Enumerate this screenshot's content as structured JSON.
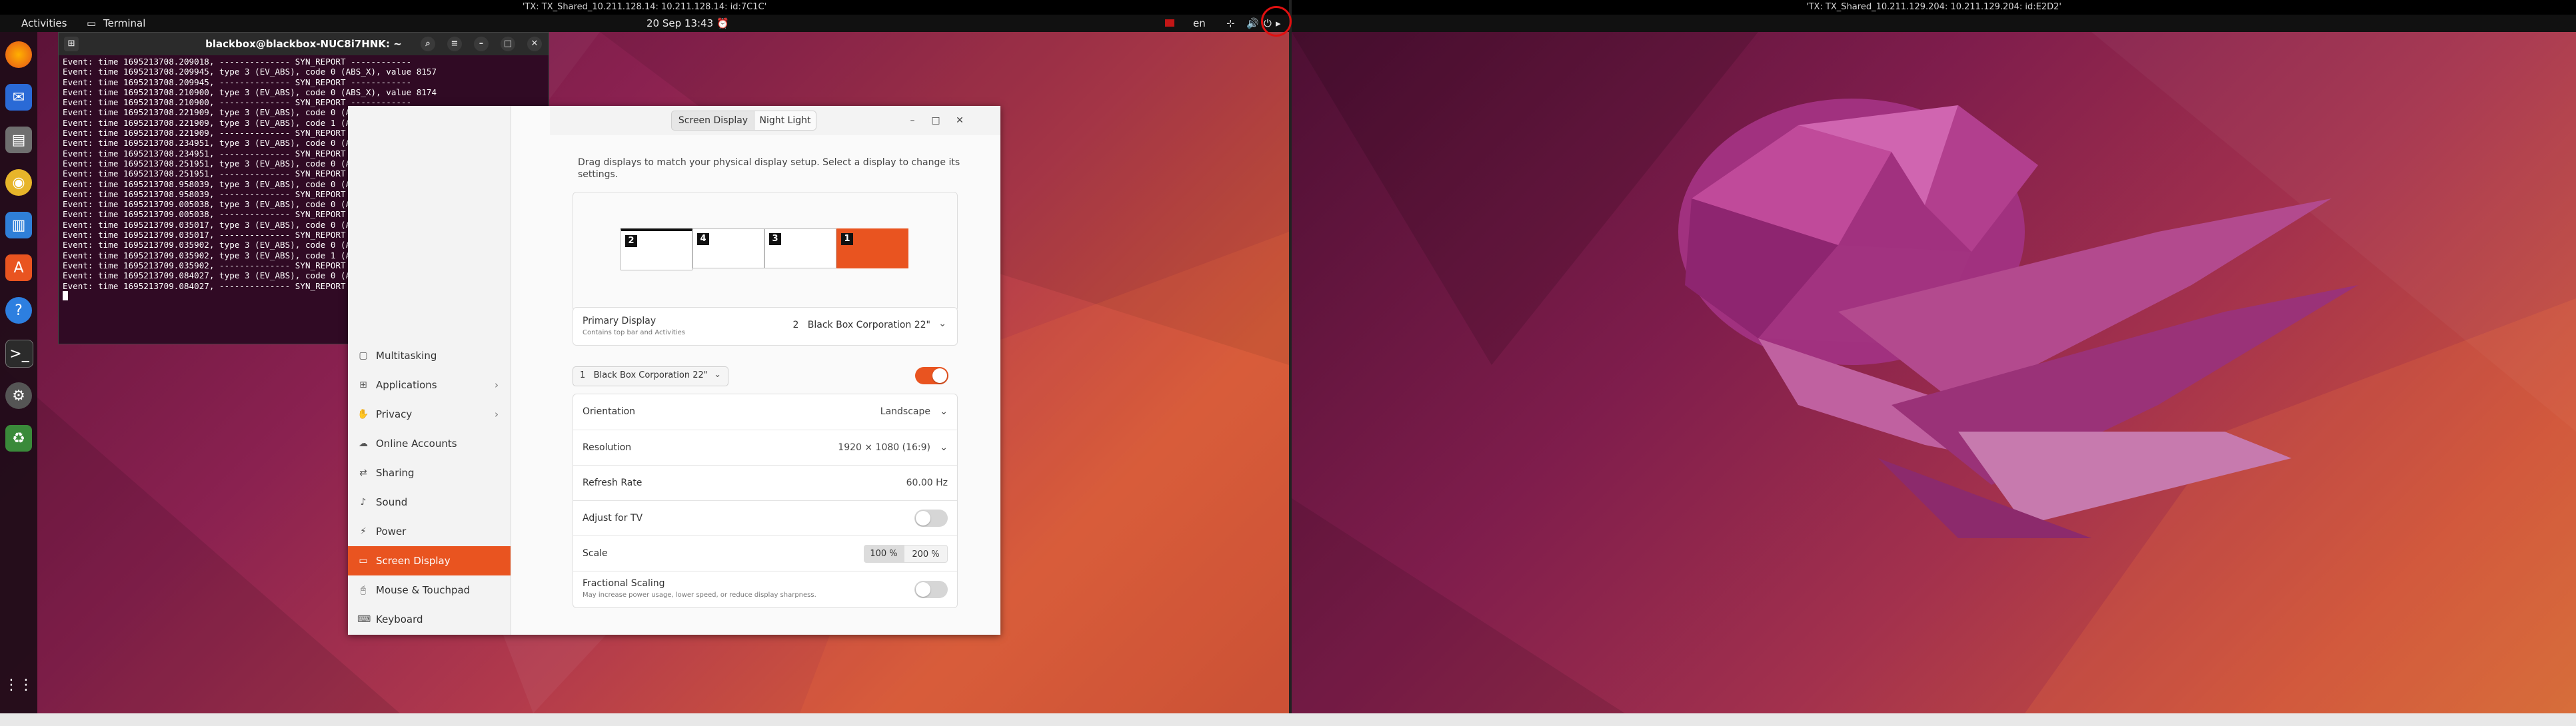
{
  "left_screen": {
    "window_title": "'TX: TX_Shared_10.211.128.14: 10.211.128.14: id:7C1C'",
    "panel": {
      "activities": "Activities",
      "app_name": "Terminal",
      "datetime": "20 Sep  13:43",
      "language": "en"
    }
  },
  "right_screen": {
    "window_title": "'TX: TX_Shared_10.211.129.204: 10.211.129.204: id:E2D2'"
  },
  "terminal": {
    "title": "blackbox@blackbox-NUC8i7HNK: ~",
    "lines": [
      "Event: time 1695213708.209018, -------------- SYN_REPORT ------------",
      "Event: time 1695213708.209945, type 3 (EV_ABS), code 0 (ABS_X), value 8157",
      "Event: time 1695213708.209945, -------------- SYN_REPORT ------------",
      "Event: time 1695213708.210900, type 3 (EV_ABS), code 0 (ABS_X), value 8174",
      "Event: time 1695213708.210900, -------------- SYN_REPORT ------------",
      "Event: time 1695213708.221909, type 3 (EV_ABS), code 0 (ABS_X), value 8191",
      "Event: time 1695213708.221909, type 3 (EV_ABS), code 1 (ABS_Y), value 217",
      "Event: time 1695213708.221909, -------------- SYN_REPORT ------------",
      "Event: time 1695213708.234951, type 3 (EV_ABS), code 0 (ABS_X), value 8208",
      "Event: time 1695213708.234951, -------------- SYN_REPORT ------------",
      "Event: time 1695213708.251951, type 3 (EV_ABS), code 0 (ABS_X), value 8225",
      "Event: time 1695213708.251951, -------------- SYN_REPORT ------------",
      "Event: time 1695213708.958039, type 3 (EV_ABS), code 0 (ABS_X), value 8208",
      "Event: time 1695213708.958039, -------------- SYN_REPORT ------------",
      "Event: time 1695213709.005038, type 3 (EV_ABS), code 0 (ABS_X), value 8191",
      "Event: time 1695213709.005038, -------------- SYN_REPORT ------------",
      "Event: time 1695213709.035017, type 3 (EV_ABS), code 0 (ABS_X), value 8174",
      "Event: time 1695213709.035017, -------------- SYN_REPORT ------------",
      "Event: time 1695213709.035902, type 3 (EV_ABS), code 0 (ABS_X), value 8157",
      "Event: time 1695213709.035902, type 3 (EV_ABS), code 1 (ABS_Y), value 248",
      "Event: time 1695213709.035902, -------------- SYN_REPORT ------------",
      "Event: time 1695213709.084027, type 3 (EV_ABS), code 0 (ABS_X), value 8140",
      "Event: time 1695213709.084027, -------------- SYN_REPORT ------------"
    ]
  },
  "settings": {
    "tabs": [
      "Screen Display",
      "Night Light"
    ],
    "instructions": "Drag displays to match your physical display setup. Select a display to change its settings.",
    "monitors": [
      "2",
      "4",
      "3",
      "1"
    ],
    "primary_display": {
      "label": "Primary Display",
      "sub": "Contains top bar and Activities",
      "value": "2   Black Box Corporation 22\""
    },
    "selected_display": "1   Black Box Corporation 22\"",
    "rows": {
      "orientation": {
        "label": "Orientation",
        "value": "Landscape"
      },
      "resolution": {
        "label": "Resolution",
        "value": "1920 × 1080 (16:9)"
      },
      "refresh": {
        "label": "Refresh Rate",
        "value": "60.00 Hz"
      },
      "adjust_tv": {
        "label": "Adjust for TV"
      },
      "scale": {
        "label": "Scale",
        "options": [
          "100 %",
          "200 %"
        ]
      },
      "fractional": {
        "label": "Fractional Scaling",
        "sub": "May increase power usage, lower speed, or reduce display sharpness."
      }
    },
    "sidebar": [
      {
        "label": "Multitasking",
        "icon": "multitasking-icon",
        "chev": ""
      },
      {
        "label": "Applications",
        "icon": "applications-icon",
        "chev": "›"
      },
      {
        "label": "Privacy",
        "icon": "privacy-icon",
        "chev": "›"
      },
      {
        "label": "Online Accounts",
        "icon": "online-accounts-icon",
        "chev": ""
      },
      {
        "label": "Sharing",
        "icon": "sharing-icon",
        "chev": ""
      },
      {
        "label": "Sound",
        "icon": "sound-icon",
        "chev": ""
      },
      {
        "label": "Power",
        "icon": "power-icon",
        "chev": ""
      },
      {
        "label": "Screen Display",
        "icon": "display-icon",
        "chev": ""
      },
      {
        "label": "Mouse & Touchpad",
        "icon": "mouse-icon",
        "chev": ""
      },
      {
        "label": "Keyboard",
        "icon": "keyboard-icon",
        "chev": ""
      }
    ]
  },
  "colors": {
    "accent": "#e95420",
    "terminal_bg": "#300a24",
    "highlight_circle": "#e01010"
  }
}
